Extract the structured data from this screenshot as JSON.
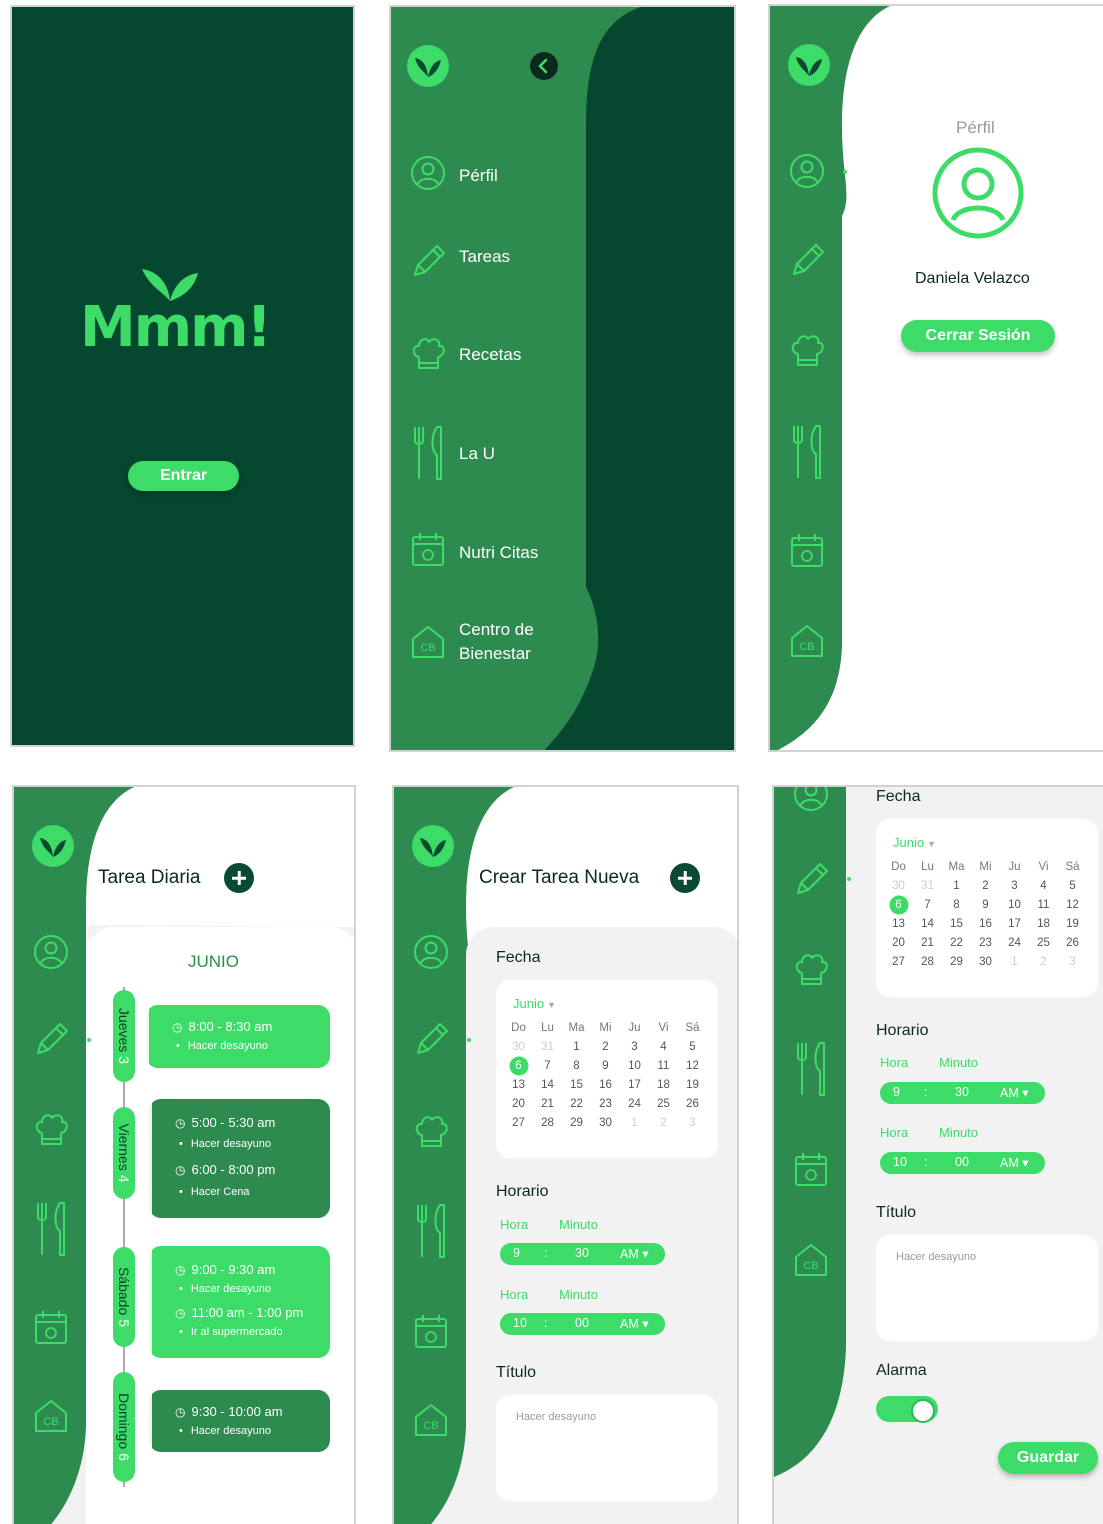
{
  "splash": {
    "brand": "Mmm!",
    "enter_button": "Entrar"
  },
  "menu": {
    "items": [
      {
        "label": "Pérfil",
        "icon": "user-icon"
      },
      {
        "label": "Tareas",
        "icon": "pencil-icon"
      },
      {
        "label": "Recetas",
        "icon": "chef-hat-icon"
      },
      {
        "label": "La U",
        "icon": "fork-knife-icon"
      },
      {
        "label": "Nutri Citas",
        "icon": "calendar-apple-icon"
      },
      {
        "label": "Centro de",
        "label2": "Bienestar",
        "icon": "cb-house-icon"
      }
    ]
  },
  "profile": {
    "title": "Pérfil",
    "name": "Daniela Velazco",
    "logout_button": "Cerrar Sesión"
  },
  "schedule": {
    "title": "Tarea Diaria",
    "month": "JUNIO",
    "days": [
      {
        "name": "Jueves",
        "num": "3",
        "tasks": [
          {
            "time": "8:00 - 8:30 am",
            "desc": "Hacer desayuno"
          }
        ]
      },
      {
        "name": "Viernes",
        "num": "4",
        "tasks": [
          {
            "time": "5:00 - 5:30 am",
            "desc": "Hacer desayuno"
          },
          {
            "time": "6:00 - 8:00 pm",
            "desc": "Hacer Cena"
          }
        ]
      },
      {
        "name": "Sábado",
        "num": "5",
        "tasks": [
          {
            "time": "9:00 - 9:30 am",
            "desc": "Hacer desayuno"
          },
          {
            "time": "11:00 am - 1:00 pm",
            "desc": "Ir al supermercado"
          }
        ]
      },
      {
        "name": "Domingo",
        "num": "6",
        "tasks": [
          {
            "time": "9:30 - 10:00 am",
            "desc": "Hacer desayuno"
          }
        ]
      }
    ]
  },
  "new_task": {
    "title": "Crear Tarea Nueva",
    "date_label": "Fecha",
    "schedule_label": "Horario",
    "title_label": "Título",
    "alarm_label": "Alarma",
    "save_button": "Guardar",
    "hour_label": "Hora",
    "minute_label": "Minuto",
    "times": [
      {
        "hour": "9",
        "sep": ":",
        "minute": "30",
        "ampm": "AM ▾"
      },
      {
        "hour": "10",
        "sep": ":",
        "minute": "00",
        "ampm": "AM ▾"
      }
    ],
    "title_placeholder": "Hacer desayuno",
    "alarm_on": true
  },
  "calendar": {
    "month": "Junio",
    "weekdays": [
      "Do",
      "Lu",
      "Ma",
      "Mi",
      "Ju",
      "Vi",
      "Sá"
    ],
    "rows": [
      [
        {
          "d": "30",
          "m": true
        },
        {
          "d": "31",
          "m": true
        },
        {
          "d": "1"
        },
        {
          "d": "2"
        },
        {
          "d": "3"
        },
        {
          "d": "4"
        },
        {
          "d": "5"
        }
      ],
      [
        {
          "d": "6",
          "s": true
        },
        {
          "d": "7"
        },
        {
          "d": "8"
        },
        {
          "d": "9"
        },
        {
          "d": "10"
        },
        {
          "d": "11"
        },
        {
          "d": "12"
        }
      ],
      [
        {
          "d": "13"
        },
        {
          "d": "14"
        },
        {
          "d": "15"
        },
        {
          "d": "16"
        },
        {
          "d": "17"
        },
        {
          "d": "18"
        },
        {
          "d": "19"
        }
      ],
      [
        {
          "d": "20"
        },
        {
          "d": "21"
        },
        {
          "d": "22"
        },
        {
          "d": "23"
        },
        {
          "d": "24"
        },
        {
          "d": "25"
        },
        {
          "d": "26"
        }
      ],
      [
        {
          "d": "27"
        },
        {
          "d": "28"
        },
        {
          "d": "29"
        },
        {
          "d": "30"
        },
        {
          "d": "1",
          "m": true
        },
        {
          "d": "2",
          "m": true
        },
        {
          "d": "3",
          "m": true
        }
      ]
    ]
  },
  "colors": {
    "dark_green": "#06472f",
    "mid_green": "#2e8b4f",
    "bright_green": "#3ddc68"
  }
}
